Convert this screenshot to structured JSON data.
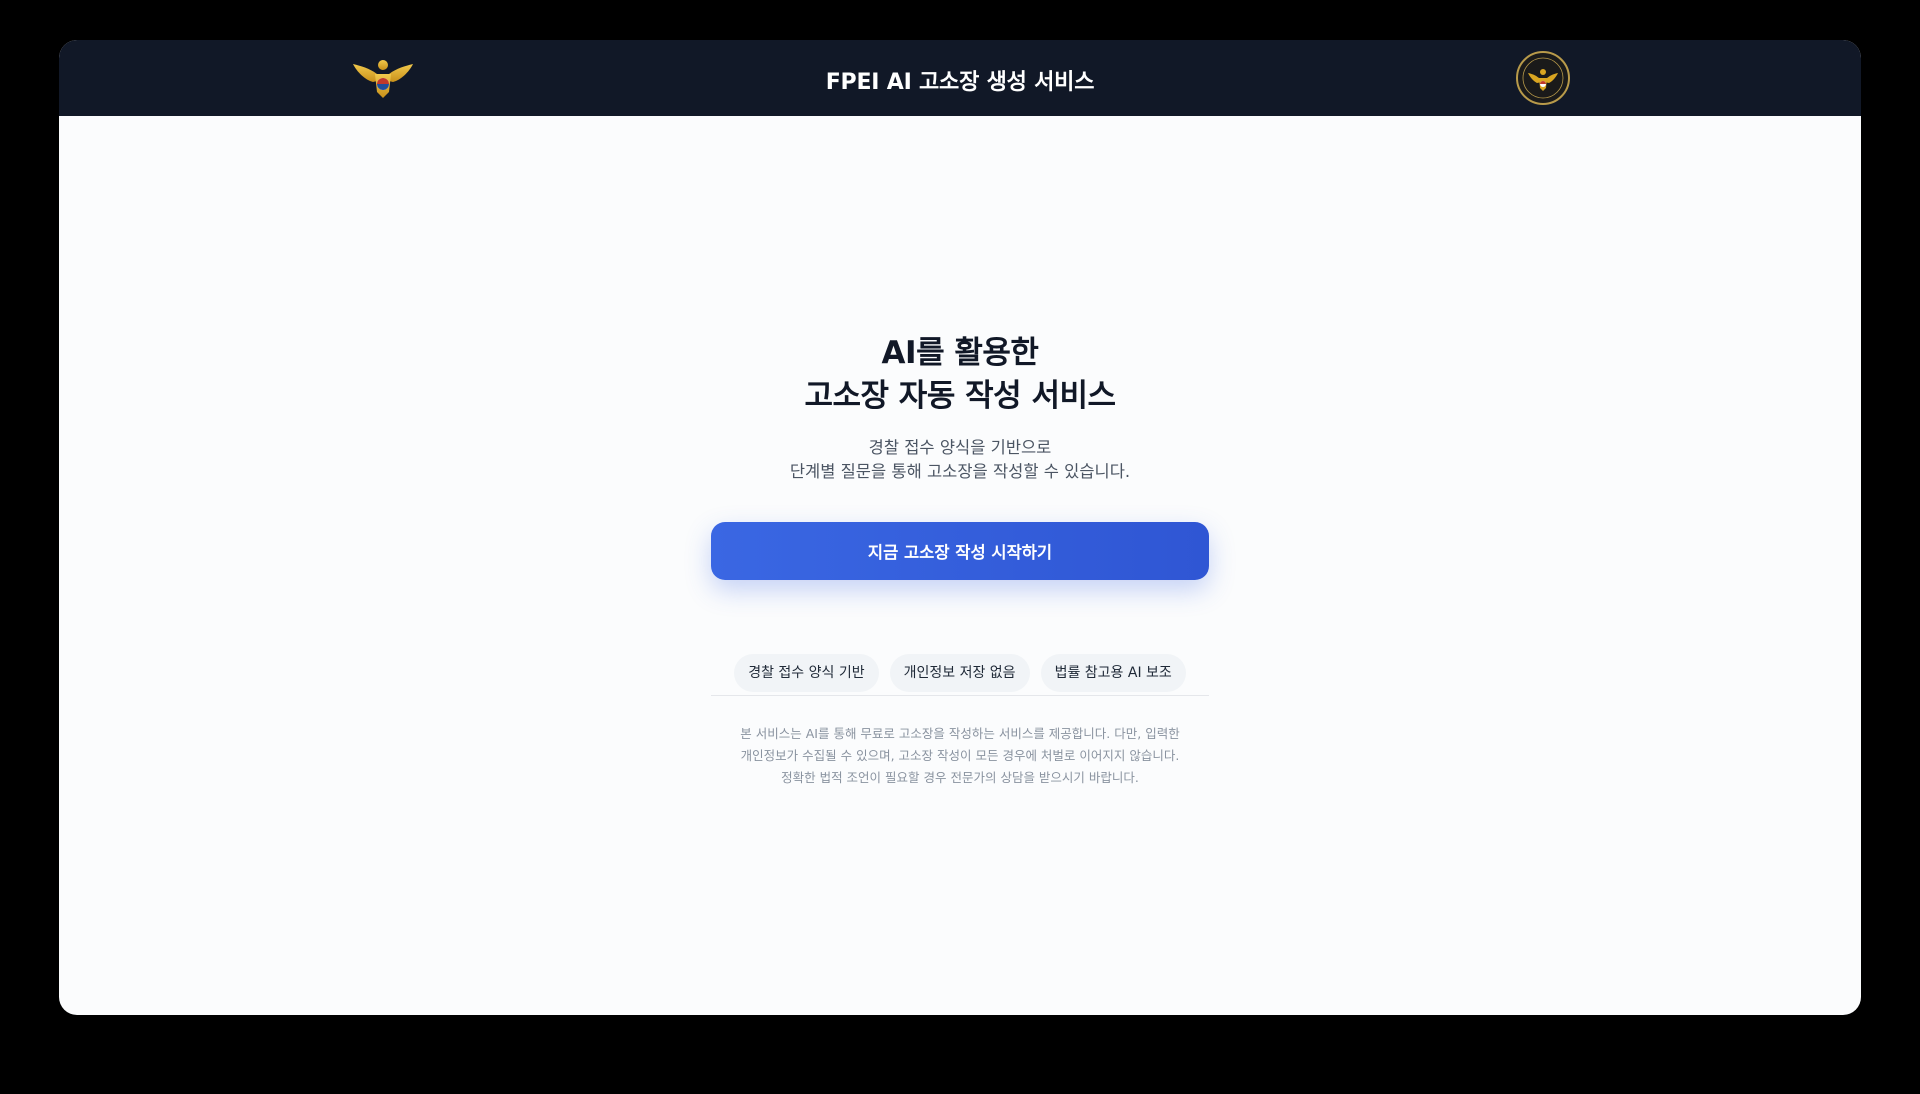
{
  "header": {
    "title": "FPEI AI 고소장 생성 서비스",
    "left_logo_icon": "police-eagle-emblem-icon",
    "right_logo_icon": "police-seal-icon"
  },
  "hero": {
    "title_line1": "AI를 활용한",
    "title_line2": "고소장 자동 작성 서비스",
    "subtitle_line1": "경찰 접수 양식을 기반으로",
    "subtitle_line2": "단계별 질문을 통해 고소장을 작성할 수 있습니다."
  },
  "cta": {
    "label": "지금 고소장 작성 시작하기"
  },
  "chips": [
    {
      "label": "경찰 접수 양식 기반"
    },
    {
      "label": "개인정보 저장 없음"
    },
    {
      "label": "법률 참고용 AI 보조"
    }
  ],
  "disclaimer": {
    "line1": "본 서비스는 AI를 통해 무료로 고소장을 작성하는 서비스를 제공합니다. 다만, 입력한",
    "line2": "개인정보가 수집될 수 있으며, 고소장 작성이 모든 경우에 처벌로 이어지지 않습니다.",
    "line3": "정확한 법적 조언이 필요할 경우 전문가의 상담을 받으시기 바랍니다."
  },
  "colors": {
    "header_bg": "#111827",
    "page_bg": "#fbfcfd",
    "accent": "#3a67e3",
    "chip_bg": "#f1f4f7",
    "emblem_gold": "#d9a521"
  }
}
